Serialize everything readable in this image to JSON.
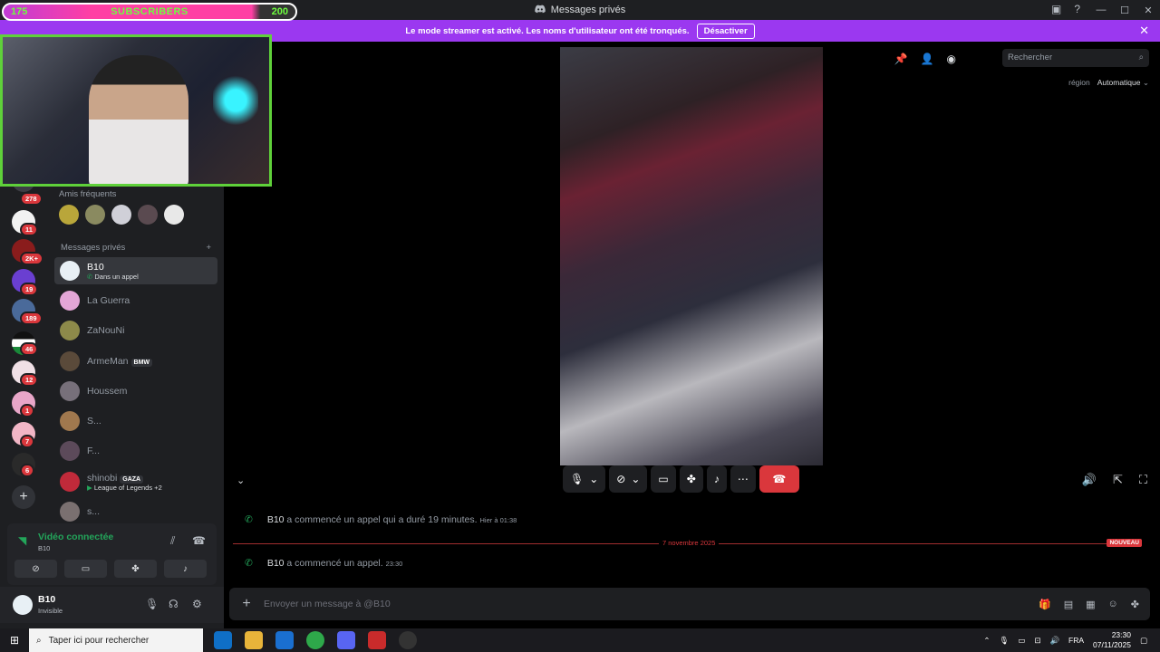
{
  "window": {
    "title": "Messages privés"
  },
  "subscribers": {
    "current": "175",
    "label": "SUBSCRIBERS",
    "goal": "200"
  },
  "banner": {
    "text": "Le mode streamer est activé. Les noms d'utilisateur ont été tronqués.",
    "button": "Désactiver"
  },
  "servers": {
    "badges": [
      "278",
      "11",
      "2K+",
      "19",
      "189",
      "46",
      "12",
      "1",
      "7",
      "6"
    ]
  },
  "sidebar": {
    "frequent_label": "Amis fréquents",
    "dm_label": "Messages privés",
    "dms": [
      {
        "name": "B10",
        "sub": "Dans un appel",
        "active": true,
        "color": "#e8f0f5"
      },
      {
        "name": "La Guerra",
        "color": "#e3a6d6"
      },
      {
        "name": "ZaNouNi",
        "color": "#8d8a4a"
      },
      {
        "name": "ArmeMan",
        "tag": "BMW",
        "color": "#5a4a3a"
      },
      {
        "name": "Houssem",
        "color": "#77707a"
      },
      {
        "name": "S...",
        "color": "#a0784e"
      },
      {
        "name": "F...",
        "color": "#5c4a5a"
      },
      {
        "name": "shinobi",
        "tag": "GAZA",
        "sub": "League of Legends +2",
        "color": "#c02a3a"
      },
      {
        "name": "s...",
        "color": "#7a7070"
      }
    ]
  },
  "voice": {
    "status": "Vidéo connectée",
    "server": "B10"
  },
  "user": {
    "name": "B10",
    "status": "Invisible"
  },
  "main": {
    "search_placeholder": "Rechercher",
    "region_label": "région",
    "region_value": "Automatique"
  },
  "chat": {
    "msg1_user": "B10",
    "msg1_text": "a commencé un appel qui a duré 19 minutes.",
    "msg1_time": "Hier à 01:38",
    "divider_date": "7 novembre 2025",
    "divider_new": "NOUVEAU",
    "msg2_user": "B10",
    "msg2_text": "a commencé un appel.",
    "msg2_time": "23:30",
    "composer_placeholder": "Envoyer un message à @B10"
  },
  "taskbar": {
    "search_placeholder": "Taper ici pour rechercher",
    "lang": "FRA",
    "time": "23:30",
    "date": "07/11/2025"
  }
}
